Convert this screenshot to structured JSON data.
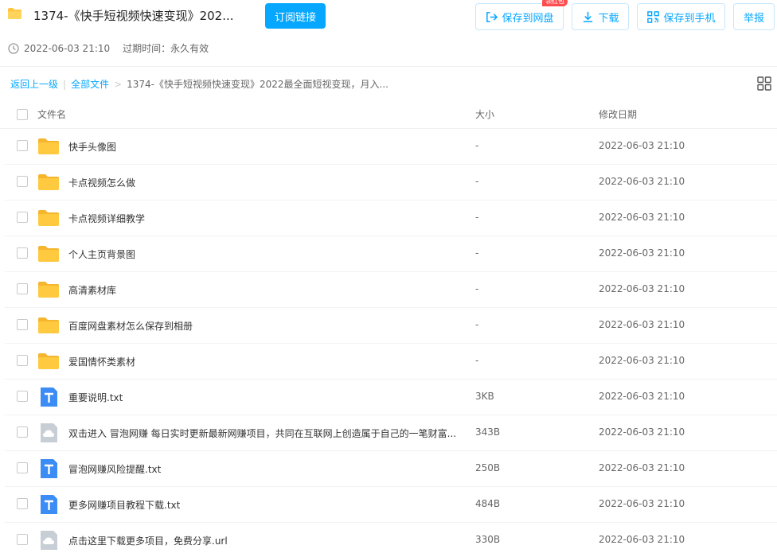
{
  "header": {
    "title": "1374-《快手短视频快速变现》202...",
    "subscribe_label": "订阅链接",
    "save_label": "保存到网盘",
    "save_badge": "领红包",
    "download_label": "下载",
    "save_phone_label": "保存到手机",
    "report_label": "举报"
  },
  "meta": {
    "created": "2022-06-03 21:10",
    "expire": "过期时间：永久有效"
  },
  "breadcrumb": {
    "back": "返回上一级",
    "sep1": "|",
    "all_files": "全部文件",
    "sep2": ">",
    "current": "1374-《快手短视频快速变现》2022最全面短视变现，月入..."
  },
  "table": {
    "columns": {
      "name": "文件名",
      "size": "大小",
      "date": "修改日期"
    },
    "rows": [
      {
        "type": "folder",
        "name": "快手头像图",
        "size": "-",
        "date": "2022-06-03 21:10"
      },
      {
        "type": "folder",
        "name": "卡点视频怎么做",
        "size": "-",
        "date": "2022-06-03 21:10"
      },
      {
        "type": "folder",
        "name": "卡点视频详细教学",
        "size": "-",
        "date": "2022-06-03 21:10"
      },
      {
        "type": "folder",
        "name": "个人主页背景图",
        "size": "-",
        "date": "2022-06-03 21:10"
      },
      {
        "type": "folder",
        "name": "高清素材库",
        "size": "-",
        "date": "2022-06-03 21:10"
      },
      {
        "type": "folder",
        "name": "百度网盘素材怎么保存到相册",
        "size": "-",
        "date": "2022-06-03 21:10"
      },
      {
        "type": "folder",
        "name": "爱国情怀类素材",
        "size": "-",
        "date": "2022-06-03 21:10"
      },
      {
        "type": "txt",
        "name": "重要说明.txt",
        "size": "3KB",
        "date": "2022-06-03 21:10"
      },
      {
        "type": "url",
        "name": "双击进入 冒泡网赚 每日实时更新最新网赚项目，共同在互联网上创造属于自己的一笔财富...",
        "size": "343B",
        "date": "2022-06-03 21:10"
      },
      {
        "type": "txt",
        "name": "冒泡网赚风险提醒.txt",
        "size": "250B",
        "date": "2022-06-03 21:10"
      },
      {
        "type": "txt",
        "name": "更多网赚项目教程下载.txt",
        "size": "484B",
        "date": "2022-06-03 21:10"
      },
      {
        "type": "url",
        "name": "点击这里下载更多项目，免费分享.url",
        "size": "330B",
        "date": "2022-06-03 21:10"
      }
    ]
  },
  "colors": {
    "accent": "#06a7ff",
    "folder": "#ffc53d",
    "txt_icon": "#3c8cf5",
    "url_icon": "#c8ced6"
  }
}
